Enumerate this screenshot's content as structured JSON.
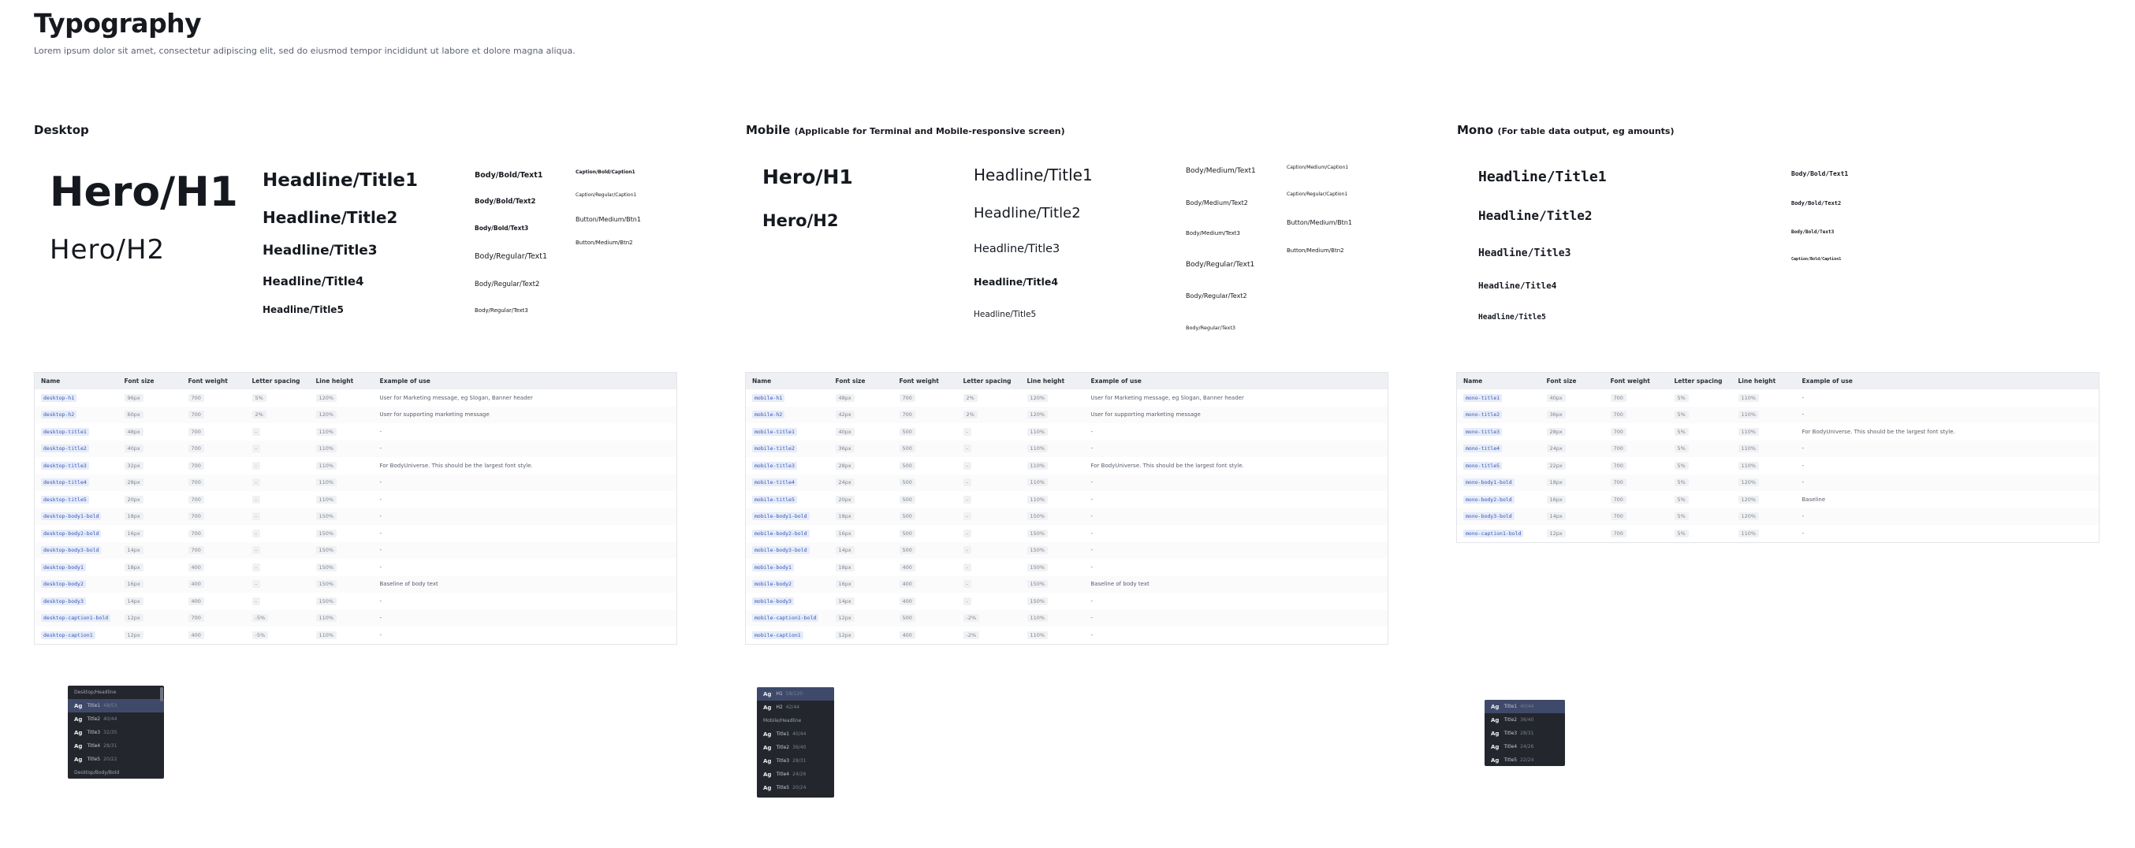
{
  "page": {
    "title": "Typography",
    "subtitle": "Lorem ipsum dolor sit amet, consectetur adipiscing elit, sed do eiusmod tempor incididunt ut labore et dolore magna aliqua."
  },
  "table_headers": [
    "Name",
    "Font size",
    "Font weight",
    "Letter spacing",
    "Line height",
    "Example of use"
  ],
  "desktop": {
    "title": "Desktop",
    "specimens": {
      "h1": "Hero/H1",
      "h2": "Hero/H2",
      "title1": "Headline/Title1",
      "title2": "Headline/Title2",
      "title3": "Headline/Title3",
      "title4": "Headline/Title4",
      "title5": "Headline/Title5",
      "body_bold1": "Body/Bold/Text1",
      "body_bold2": "Body/Bold/Text2",
      "body_bold3": "Body/Bold/Text3",
      "body_reg1": "Body/Regular/Text1",
      "body_reg2": "Body/Regular/Text2",
      "body_reg3": "Body/Regular/Text3",
      "cap_bold": "Caption/Bold/Caption1",
      "cap_reg": "Caption/Regular/Caption1",
      "btn1": "Button/Medium/Btn1",
      "btn2": "Button/Medium/Btn2"
    },
    "rows": [
      {
        "name": "desktop-h1",
        "size": "96px",
        "weight": "700",
        "ls": "5%",
        "lh": "120%",
        "ex": "User for Marketing message, eg Slogan, Banner header"
      },
      {
        "name": "desktop-h2",
        "size": "60px",
        "weight": "700",
        "ls": "2%",
        "lh": "120%",
        "ex": "User for supporting marketing message"
      },
      {
        "name": "desktop-title1",
        "size": "48px",
        "weight": "700",
        "ls": "-",
        "lh": "110%",
        "ex": "-"
      },
      {
        "name": "desktop-title2",
        "size": "40px",
        "weight": "700",
        "ls": "-",
        "lh": "110%",
        "ex": "-"
      },
      {
        "name": "desktop-title3",
        "size": "32px",
        "weight": "700",
        "ls": "-",
        "lh": "110%",
        "ex": "For BodyUniverse. This should be the largest font style."
      },
      {
        "name": "desktop-title4",
        "size": "28px",
        "weight": "700",
        "ls": "-",
        "lh": "110%",
        "ex": "-"
      },
      {
        "name": "desktop-title5",
        "size": "20px",
        "weight": "700",
        "ls": "-",
        "lh": "110%",
        "ex": "-"
      },
      {
        "name": "desktop-body1-bold",
        "size": "18px",
        "weight": "700",
        "ls": "-",
        "lh": "150%",
        "ex": "-"
      },
      {
        "name": "desktop-body2-bold",
        "size": "16px",
        "weight": "700",
        "ls": "-",
        "lh": "150%",
        "ex": "-"
      },
      {
        "name": "desktop-body3-bold",
        "size": "14px",
        "weight": "700",
        "ls": "-",
        "lh": "150%",
        "ex": "-"
      },
      {
        "name": "desktop-body1",
        "size": "18px",
        "weight": "400",
        "ls": "-",
        "lh": "150%",
        "ex": "-"
      },
      {
        "name": "desktop-body2",
        "size": "16px",
        "weight": "400",
        "ls": "-",
        "lh": "150%",
        "ex": "Baseline of body text"
      },
      {
        "name": "desktop-body3",
        "size": "14px",
        "weight": "400",
        "ls": "-",
        "lh": "150%",
        "ex": "-"
      },
      {
        "name": "desktop-caption1-bold",
        "size": "12px",
        "weight": "700",
        "ls": "-5%",
        "lh": "110%",
        "ex": "-"
      },
      {
        "name": "desktop-caption1",
        "size": "12px",
        "weight": "400",
        "ls": "-5%",
        "lh": "110%",
        "ex": "-"
      }
    ],
    "panel": {
      "header1": "Desktop/Headline",
      "items": [
        {
          "ag": "Ag",
          "label": "Title1",
          "meta": "48/53"
        },
        {
          "ag": "Ag",
          "label": "Title2",
          "meta": "40/44"
        },
        {
          "ag": "Ag",
          "label": "Title3",
          "meta": "32/35"
        },
        {
          "ag": "Ag",
          "label": "Title4",
          "meta": "28/31"
        },
        {
          "ag": "Ag",
          "label": "Title5",
          "meta": "20/22"
        }
      ],
      "header2": "Desktop/Body/Bold"
    }
  },
  "mobile": {
    "title": "Mobile",
    "note": "(Applicable for Terminal and Mobile-responsive screen)",
    "specimens": {
      "h1": "Hero/H1",
      "h2": "Hero/H2",
      "title1": "Headline/Title1",
      "title2": "Headline/Title2",
      "title3": "Headline/Title3",
      "title4": "Headline/Title4",
      "title5": "Headline/Title5",
      "body_med1": "Body/Medium/Text1",
      "body_med2": "Body/Medium/Text2",
      "body_med3": "Body/Medium/Text3",
      "body_reg1": "Body/Regular/Text1",
      "body_reg2": "Body/Regular/Text2",
      "body_reg3": "Body/Regular/Text3",
      "cap_med": "Caption/Medium/Caption1",
      "cap_reg": "Caption/Regular/Caption1",
      "btn1": "Button/Medium/Btn1",
      "btn2": "Button/Medium/Btn2"
    },
    "rows": [
      {
        "name": "mobile-h1",
        "size": "48px",
        "weight": "700",
        "ls": "2%",
        "lh": "120%",
        "ex": "User for Marketing message, eg Slogan, Banner header"
      },
      {
        "name": "mobile-h2",
        "size": "42px",
        "weight": "700",
        "ls": "2%",
        "lh": "120%",
        "ex": "User for supporting marketing message"
      },
      {
        "name": "mobile-title1",
        "size": "40px",
        "weight": "500",
        "ls": "-",
        "lh": "110%",
        "ex": "-"
      },
      {
        "name": "mobile-title2",
        "size": "36px",
        "weight": "500",
        "ls": "-",
        "lh": "110%",
        "ex": "-"
      },
      {
        "name": "mobile-title3",
        "size": "28px",
        "weight": "500",
        "ls": "-",
        "lh": "110%",
        "ex": "For BodyUniverse. This should be the largest font style."
      },
      {
        "name": "mobile-title4",
        "size": "24px",
        "weight": "500",
        "ls": "-",
        "lh": "110%",
        "ex": "-"
      },
      {
        "name": "mobile-title5",
        "size": "20px",
        "weight": "500",
        "ls": "-",
        "lh": "110%",
        "ex": "-"
      },
      {
        "name": "mobile-body1-bold",
        "size": "18px",
        "weight": "500",
        "ls": "-",
        "lh": "150%",
        "ex": "-"
      },
      {
        "name": "mobile-body2-bold",
        "size": "16px",
        "weight": "500",
        "ls": "-",
        "lh": "150%",
        "ex": "-"
      },
      {
        "name": "mobile-body3-bold",
        "size": "14px",
        "weight": "500",
        "ls": "-",
        "lh": "150%",
        "ex": "-"
      },
      {
        "name": "mobile-body1",
        "size": "18px",
        "weight": "400",
        "ls": "-",
        "lh": "150%",
        "ex": "-"
      },
      {
        "name": "mobile-body2",
        "size": "16px",
        "weight": "400",
        "ls": "-",
        "lh": "150%",
        "ex": "Baseline of body text"
      },
      {
        "name": "mobile-body3",
        "size": "14px",
        "weight": "400",
        "ls": "-",
        "lh": "150%",
        "ex": "-"
      },
      {
        "name": "mobile-caption1-bold",
        "size": "12px",
        "weight": "500",
        "ls": "-2%",
        "lh": "110%",
        "ex": "-"
      },
      {
        "name": "mobile-caption1",
        "size": "12px",
        "weight": "400",
        "ls": "-2%",
        "lh": "110%",
        "ex": "-"
      }
    ],
    "panel": {
      "items_top": [
        {
          "ag": "Ag",
          "label": "H1",
          "meta": "58/120"
        },
        {
          "ag": "Ag",
          "label": "H2",
          "meta": "42/44"
        }
      ],
      "header": "Mobile/Headline",
      "items": [
        {
          "ag": "Ag",
          "label": "Title1",
          "meta": "40/44"
        },
        {
          "ag": "Ag",
          "label": "Title2",
          "meta": "36/40"
        },
        {
          "ag": "Ag",
          "label": "Title3",
          "meta": "28/31"
        },
        {
          "ag": "Ag",
          "label": "Title4",
          "meta": "24/26"
        },
        {
          "ag": "Ag",
          "label": "Title5",
          "meta": "20/24"
        }
      ]
    }
  },
  "mono": {
    "title": "Mono",
    "note": "(For table data output, eg amounts)",
    "specimens": {
      "title1": "Headline/Title1",
      "title2": "Headline/Title2",
      "title3": "Headline/Title3",
      "title4": "Headline/Title4",
      "title5": "Headline/Title5",
      "body_bold1": "Body/Bold/Text1",
      "body_bold2": "Body/Bold/Text2",
      "body_bold3": "Body/Bold/Text3",
      "cap_bold": "Caption/Bold/Caption1"
    },
    "rows": [
      {
        "name": "mono-title1",
        "size": "40px",
        "weight": "700",
        "ls": "5%",
        "lh": "110%",
        "ex": "-"
      },
      {
        "name": "mono-title2",
        "size": "36px",
        "weight": "700",
        "ls": "5%",
        "lh": "110%",
        "ex": "-"
      },
      {
        "name": "mono-title3",
        "size": "28px",
        "weight": "700",
        "ls": "5%",
        "lh": "110%",
        "ex": "For BodyUniverse. This should be the largest font style."
      },
      {
        "name": "mono-title4",
        "size": "24px",
        "weight": "700",
        "ls": "5%",
        "lh": "110%",
        "ex": "-"
      },
      {
        "name": "mono-title5",
        "size": "22px",
        "weight": "700",
        "ls": "5%",
        "lh": "110%",
        "ex": "-"
      },
      {
        "name": "mono-body1-bold",
        "size": "18px",
        "weight": "700",
        "ls": "5%",
        "lh": "120%",
        "ex": "-"
      },
      {
        "name": "mono-body2-bold",
        "size": "16px",
        "weight": "700",
        "ls": "5%",
        "lh": "120%",
        "ex": "Baseline"
      },
      {
        "name": "mono-body3-bold",
        "size": "14px",
        "weight": "700",
        "ls": "5%",
        "lh": "120%",
        "ex": "-"
      },
      {
        "name": "mono-caption1-bold",
        "size": "12px",
        "weight": "700",
        "ls": "5%",
        "lh": "110%",
        "ex": "-"
      }
    ],
    "panel": {
      "items": [
        {
          "ag": "Ag",
          "label": "Title1",
          "meta": "40/44"
        },
        {
          "ag": "Ag",
          "label": "Title2",
          "meta": "36/40"
        },
        {
          "ag": "Ag",
          "label": "Title3",
          "meta": "28/31"
        },
        {
          "ag": "Ag",
          "label": "Title4",
          "meta": "24/26"
        },
        {
          "ag": "Ag",
          "label": "Title5",
          "meta": "22/24"
        }
      ]
    }
  }
}
